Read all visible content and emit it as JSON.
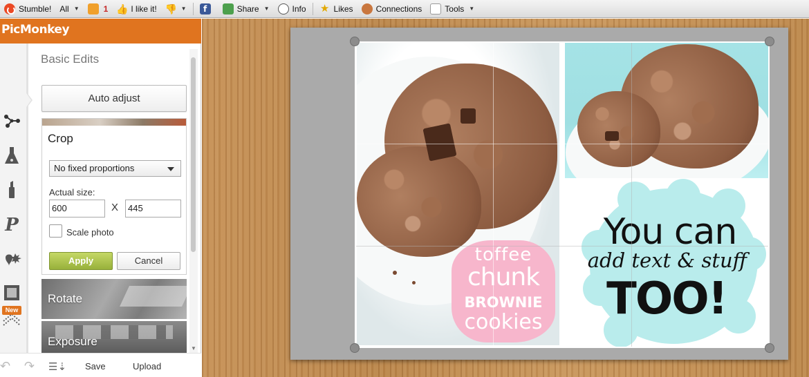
{
  "toolbar": {
    "stumble": "Stumble!",
    "all": "All",
    "bag_count": "1",
    "ilike": "I like it!",
    "share": "Share",
    "info": "Info",
    "likes": "Likes",
    "connections": "Connections",
    "tools": "Tools"
  },
  "panel": {
    "logo": "PicMonkey",
    "section_title": "Basic Edits",
    "auto_adjust": "Auto adjust",
    "crop": {
      "title": "Crop",
      "proportion_selected": "No fixed proportions",
      "actual_size_label": "Actual size:",
      "width_value": "600",
      "times": "X",
      "height_value": "445",
      "scale_label": "Scale photo",
      "scale_checked": false,
      "apply": "Apply",
      "cancel": "Cancel"
    },
    "tiles": {
      "rotate": "Rotate",
      "exposure": "Exposure"
    },
    "rail_badge": "New",
    "bottom": {
      "save": "Save",
      "upload": "Upload"
    }
  },
  "collage": {
    "pink_label": {
      "line1": "toffee",
      "line2": "chunk",
      "line3": "BROWNIE",
      "line4": "cookies"
    },
    "caption": {
      "line1": "You can",
      "line2": "add text & stuff",
      "line3": "TOO!"
    }
  },
  "colors": {
    "brand": "#e0741f",
    "apply_green": "#a2ba43",
    "aqua": "#b9ecec",
    "pink": "#f7b6cc",
    "wood": "#c08d52"
  },
  "icons": {
    "rail": [
      "effects-icon",
      "potion-icon",
      "lipstick-icon",
      "text-p-icon",
      "overlays-icon",
      "frames-icon",
      "textures-icon"
    ]
  }
}
